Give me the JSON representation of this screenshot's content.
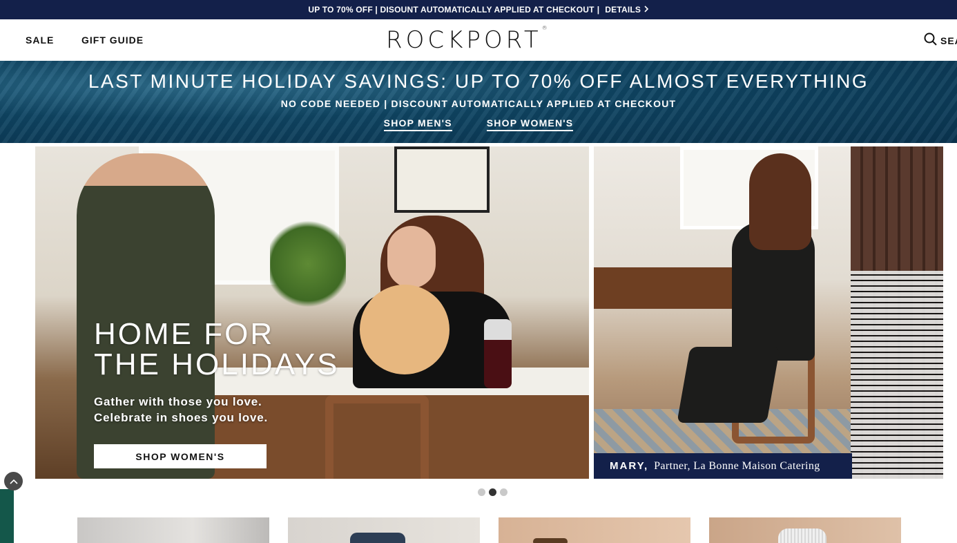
{
  "promo_bar": {
    "text": "UP TO 70% OFF | DISOUNT AUTOMATICALLY APPLIED AT CHECKOUT",
    "separator": "|",
    "details_label": "DETAILS",
    "details_icon": "chevron-right-icon"
  },
  "header": {
    "nav": [
      {
        "label": "SALE"
      },
      {
        "label": "GIFT GUIDE"
      }
    ],
    "logo": "ROCKPORT",
    "logo_mark": "®",
    "search_label": "SEARCH",
    "search_icon": "search-icon"
  },
  "banner": {
    "title": "LAST MINUTE HOLIDAY SAVINGS: UP TO 70% OFF ALMOST EVERYTHING",
    "subtitle": "NO CODE NEEDED | DISCOUNT AUTOMATICALLY APPLIED AT CHECKOUT",
    "links": [
      {
        "label": "SHOP MEN'S"
      },
      {
        "label": "SHOP WOMEN'S"
      }
    ]
  },
  "hero": {
    "title_line1": "HOME FOR",
    "title_line2": "THE HOLIDAYS",
    "subtitle_line1": "Gather with those you love.",
    "subtitle_line2": "Celebrate in shoes you love.",
    "cta_label": "SHOP WOMEN'S",
    "caption_name": "MARY,",
    "caption_text": "Partner, La Bonne Maison Catering"
  },
  "carousel": {
    "slide_count": 3,
    "active_index": 1
  },
  "colors": {
    "navy": "#13204a",
    "banner_blue": "#0f4563",
    "side_green": "#14574a"
  }
}
